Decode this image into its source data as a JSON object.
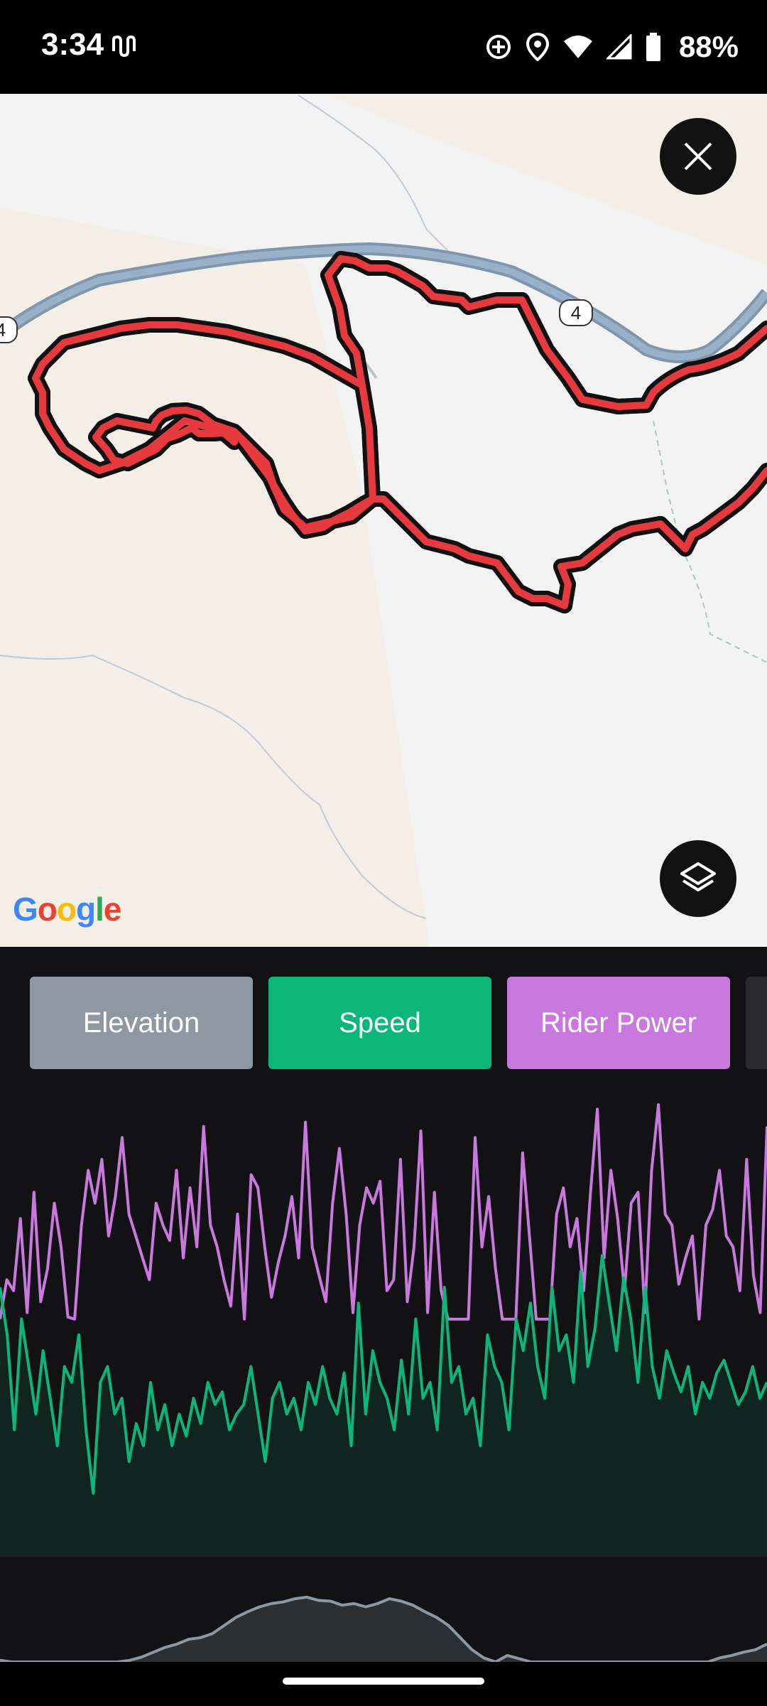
{
  "status_bar": {
    "time": "3:34",
    "battery": "88%",
    "icons": [
      "voicemail-icon",
      "sync-icon",
      "location-icon",
      "wifi-icon",
      "signal-icon",
      "battery-icon"
    ]
  },
  "map": {
    "route_label": "4",
    "road_label_left": "4",
    "provider_logo": "Google",
    "buttons": {
      "close": "close-icon",
      "layers": "layers-icon"
    },
    "colors": {
      "route": "#e63a3f",
      "road": "#8aa3bd",
      "land": "#f3efe6"
    }
  },
  "tabs": [
    {
      "label": "Elevation",
      "color": "#8e98a3"
    },
    {
      "label": "Speed",
      "color": "#0ab679"
    },
    {
      "label": "Rider Power",
      "color": "#c978dd"
    }
  ],
  "chart_data": [
    {
      "type": "line",
      "series": [
        {
          "name": "Rider Power",
          "color": "#c978dd",
          "values": [
            2,
            20,
            15,
            48,
            5,
            60,
            10,
            25,
            55,
            35,
            3,
            2,
            45,
            70,
            55,
            75,
            40,
            58,
            85,
            50,
            40,
            30,
            20,
            55,
            45,
            38,
            70,
            30,
            62,
            35,
            90,
            45,
            35,
            20,
            8,
            50,
            2,
            68,
            62,
            35,
            12,
            28,
            40,
            58,
            30,
            92,
            35,
            22,
            10,
            55,
            80,
            50,
            5,
            45,
            62,
            55,
            65,
            15,
            20,
            75,
            10,
            35,
            88,
            5,
            60,
            15,
            2,
            2,
            2,
            2,
            85,
            35,
            58,
            25,
            2,
            2,
            2,
            78,
            40,
            2,
            2,
            2,
            50,
            62,
            35,
            48,
            15,
            60,
            98,
            30,
            70,
            48,
            15,
            55,
            60,
            5,
            70,
            100,
            50,
            45,
            18,
            30,
            40,
            2,
            45,
            52,
            70,
            40,
            35,
            15,
            75,
            22,
            5,
            90
          ]
        }
      ]
    },
    {
      "type": "area",
      "series": [
        {
          "name": "Speed",
          "color": "#0ab679",
          "values": [
            85,
            70,
            40,
            75,
            60,
            45,
            65,
            50,
            35,
            60,
            55,
            70,
            40,
            20,
            55,
            60,
            45,
            50,
            30,
            42,
            35,
            55,
            40,
            48,
            35,
            45,
            38,
            50,
            42,
            55,
            48,
            52,
            40,
            45,
            48,
            60,
            45,
            30,
            50,
            55,
            45,
            50,
            40,
            55,
            48,
            60,
            50,
            45,
            58,
            35,
            80,
            45,
            65,
            55,
            50,
            40,
            62,
            45,
            75,
            50,
            55,
            40,
            85,
            55,
            60,
            45,
            50,
            35,
            70,
            60,
            55,
            40,
            75,
            65,
            80,
            60,
            50,
            85,
            65,
            70,
            55,
            90,
            60,
            72,
            95,
            80,
            65,
            88,
            75,
            55,
            85,
            60,
            50,
            65,
            58,
            52,
            60,
            45,
            55,
            50,
            58,
            62,
            55,
            48,
            52,
            60,
            50,
            55
          ]
        }
      ]
    },
    {
      "type": "area",
      "series": [
        {
          "name": "Elevation",
          "color": "#8e98a3",
          "values": [
            2,
            0,
            0,
            0,
            0,
            0,
            0,
            0,
            0,
            0,
            0,
            2,
            6,
            12,
            18,
            22,
            28,
            30,
            35,
            45,
            55,
            62,
            68,
            72,
            74,
            78,
            80,
            76,
            75,
            70,
            72,
            68,
            72,
            78,
            75,
            70,
            62,
            55,
            45,
            30,
            15,
            5,
            0,
            8,
            4,
            0,
            0,
            0,
            0,
            0,
            0,
            0,
            0,
            0,
            0,
            0,
            0,
            0,
            0,
            0,
            0,
            5,
            8,
            12,
            15,
            22
          ]
        }
      ]
    }
  ]
}
